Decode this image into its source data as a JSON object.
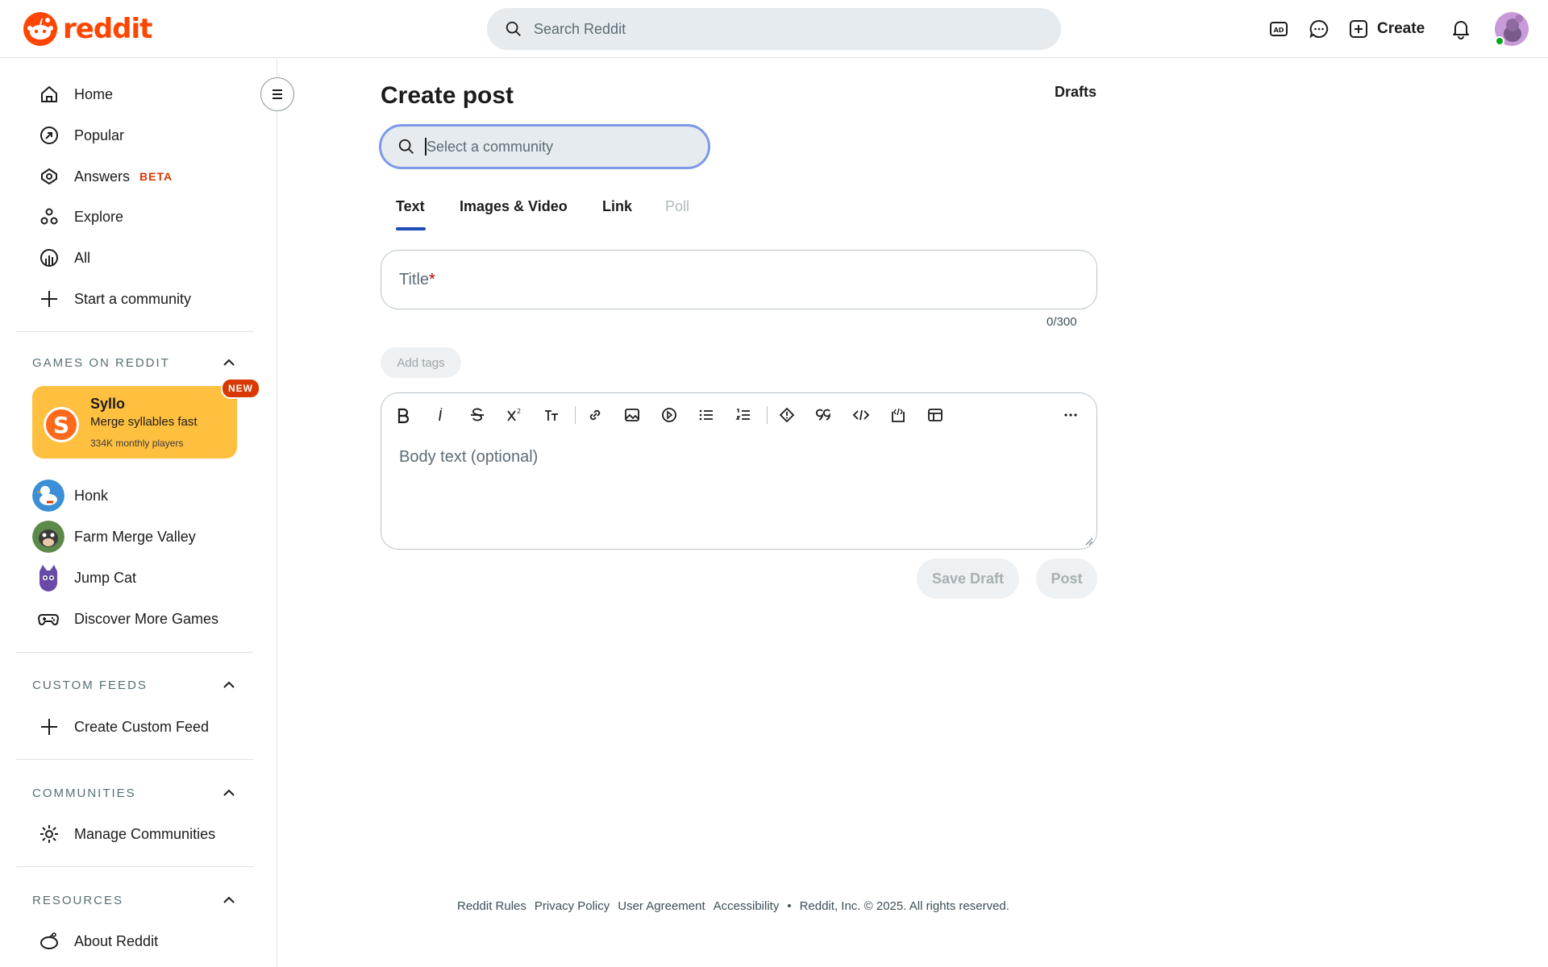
{
  "header": {
    "logo_text": "reddit",
    "search_placeholder": "Search Reddit",
    "create_label": "Create",
    "icons": [
      "advertise-icon",
      "chat-icon",
      "create-icon",
      "notification-icon",
      "avatar"
    ],
    "accent_color": "#ff4500"
  },
  "sidebar": {
    "nav": [
      {
        "label": "Home",
        "icon": "home-icon"
      },
      {
        "label": "Popular",
        "icon": "popular-icon"
      },
      {
        "label": "Answers",
        "icon": "answers-icon",
        "badge": "BETA"
      },
      {
        "label": "Explore",
        "icon": "explore-icon"
      },
      {
        "label": "All",
        "icon": "all-icon"
      },
      {
        "label": "Start a community",
        "icon": "plus-icon"
      }
    ],
    "games_section": {
      "title": "GAMES ON REDDIT",
      "featured": {
        "name": "Syllo",
        "tagline": "Merge syllables fast",
        "players": "334K monthly players",
        "badge": "NEW",
        "logo_letter": "S",
        "color": "#ffbf3f"
      },
      "games": [
        {
          "label": "Honk"
        },
        {
          "label": "Farm Merge Valley"
        },
        {
          "label": "Jump Cat"
        },
        {
          "label": "Discover More Games",
          "icon": "gamepad-icon"
        }
      ]
    },
    "custom_feeds": {
      "title": "CUSTOM FEEDS",
      "item": "Create Custom Feed"
    },
    "communities": {
      "title": "COMMUNITIES",
      "item": "Manage Communities"
    },
    "resources": {
      "title": "RESOURCES",
      "item": "About Reddit"
    }
  },
  "main": {
    "title": "Create post",
    "drafts": "Drafts",
    "community_placeholder": "Select a community",
    "tabs": [
      {
        "label": "Text",
        "active": true
      },
      {
        "label": "Images & Video"
      },
      {
        "label": "Link"
      },
      {
        "label": "Poll",
        "disabled": true
      }
    ],
    "title_placeholder": "Title",
    "title_required_mark": "*",
    "title_counter": "0/300",
    "add_tags": "Add tags",
    "body_placeholder": "Body text (optional)",
    "toolbar": [
      "bold-icon",
      "italic-icon",
      "strikethrough-icon",
      "superscript-icon",
      "heading-icon",
      "link-icon",
      "image-icon",
      "video-icon",
      "bullet-list-icon",
      "numbered-list-icon",
      "spoiler-icon",
      "quote-icon",
      "code-icon",
      "code-block-icon",
      "table-icon",
      "more-icon"
    ],
    "save_draft": "Save Draft",
    "post": "Post"
  },
  "footer": {
    "links": [
      "Reddit Rules",
      "Privacy Policy",
      "User Agreement",
      "Accessibility"
    ],
    "separator": "•",
    "copyright": "Reddit, Inc. © 2025. All rights reserved."
  }
}
